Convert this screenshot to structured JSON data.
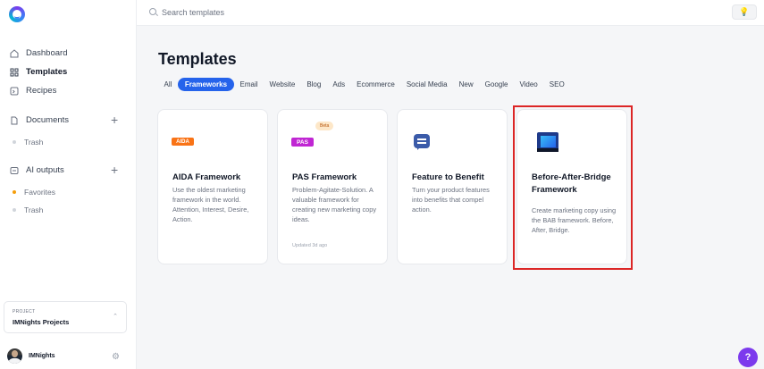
{
  "sidebar": {
    "nav": [
      {
        "label": "Dashboard",
        "icon": "home-icon"
      },
      {
        "label": "Templates",
        "icon": "grid-icon",
        "active": true
      },
      {
        "label": "Recipes",
        "icon": "recipe-icon"
      }
    ],
    "documents": {
      "label": "Documents",
      "sub": [
        "Trash"
      ]
    },
    "ai_outputs": {
      "label": "AI outputs",
      "sub": [
        "Favorites",
        "Trash"
      ]
    },
    "project": {
      "label": "PROJECT",
      "value": "IMNights Projects"
    },
    "user": {
      "name": "IMNights"
    }
  },
  "topbar": {
    "search_placeholder": "Search templates"
  },
  "main": {
    "title": "Templates",
    "tabs": [
      "All",
      "Frameworks",
      "Email",
      "Website",
      "Blog",
      "Ads",
      "Ecommerce",
      "Social Media",
      "New",
      "Google",
      "Video",
      "SEO"
    ],
    "active_tab": "Frameworks",
    "cards": [
      {
        "title": "AIDA Framework",
        "icon_text": "AIDA",
        "desc": "Use the oldest marketing framework in the world. Attention, Interest, Desire, Action."
      },
      {
        "title": "PAS Framework",
        "icon_text": "PAS",
        "badge": "Beta",
        "desc": "Problem-Agitate-Solution. A valuable framework for creating new marketing copy ideas.",
        "updated": "Updated 3d ago"
      },
      {
        "title": "Feature to Benefit",
        "desc": "Turn your product features into benefits that compel action."
      },
      {
        "title": "Before-After-Bridge Framework",
        "desc": "Create marketing copy using the BAB framework. Before, After, Bridge."
      }
    ]
  },
  "help": {
    "label": "?"
  },
  "colors": {
    "accent": "#2563eb",
    "highlight": "#dc2626",
    "help": "#7c3aed"
  }
}
